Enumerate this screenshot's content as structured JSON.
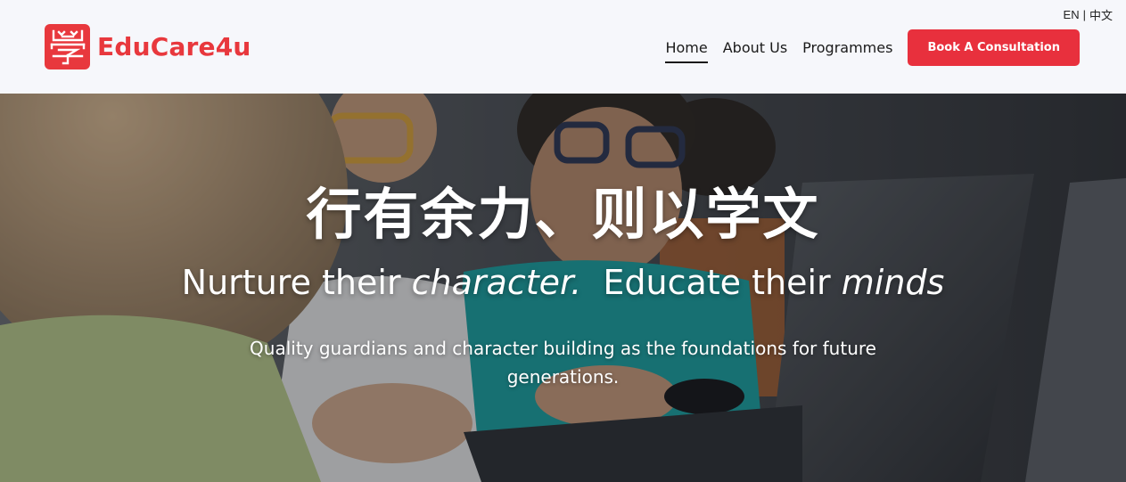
{
  "header": {
    "lang": {
      "en": "EN",
      "separator": "|",
      "zh": "中文"
    },
    "logo": {
      "text": "EduCare4u",
      "mark_glyph": "學"
    },
    "nav": [
      {
        "label": "Home",
        "active": true
      },
      {
        "label": "About Us",
        "active": false
      },
      {
        "label": "Programmes",
        "active": false
      }
    ],
    "cta_label": "Book A Consultation"
  },
  "hero": {
    "title_cn": "行有余力、则以学文",
    "tagline": {
      "part1": "Nurture their ",
      "em1": "character.",
      "part2": "  Educate their ",
      "em2": "minds"
    },
    "subtitle": "Quality guardians and character building as the foundations for future generations."
  },
  "colors": {
    "brand_red": "#e8383d",
    "cta_red": "#e8303d",
    "header_bg": "#f6f7fb"
  }
}
